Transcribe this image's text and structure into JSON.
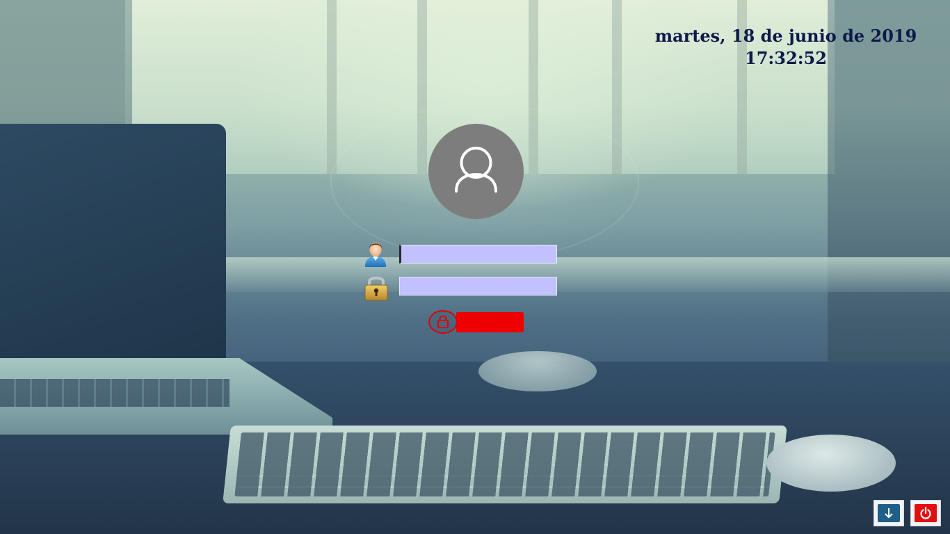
{
  "clock": {
    "date": "martes, 18 de junio de 2019",
    "time": "17:32:52"
  },
  "avatar": {
    "icon": "user-silhouette-icon"
  },
  "login": {
    "username": {
      "icon": "user-person-icon",
      "value": "",
      "placeholder": ""
    },
    "password": {
      "icon": "padlock-icon",
      "value": "",
      "placeholder": ""
    },
    "submit": {
      "icon": "lock-icon",
      "label": ""
    }
  },
  "corner_buttons": {
    "download": {
      "icon": "download-arrow-icon"
    },
    "power": {
      "icon": "power-icon"
    }
  },
  "colors": {
    "clock_text": "#0d1a4a",
    "avatar_bg": "#7d7d7d",
    "input_bg": "#c1c1ff",
    "login_button": "#ee0000",
    "download_button": "#1f5f8a",
    "power_button": "#e11010"
  }
}
